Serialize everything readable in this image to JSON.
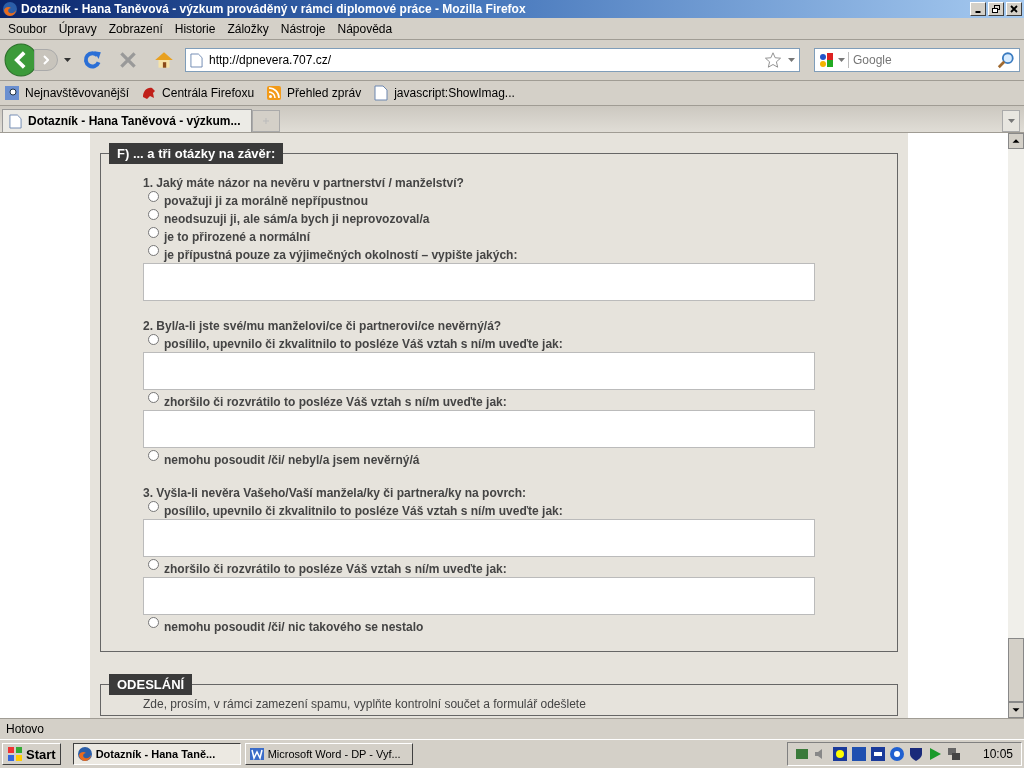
{
  "window": {
    "title": "Dotazník - Hana Taněvová - výzkum prováděný v rámci diplomové práce - Mozilla Firefox"
  },
  "menu": [
    "Soubor",
    "Úpravy",
    "Zobrazení",
    "Historie",
    "Záložky",
    "Nástroje",
    "Nápověda"
  ],
  "address_bar": {
    "value": "http://dpnevera.707.cz/"
  },
  "search": {
    "placeholder": "Google"
  },
  "bookmarks": [
    {
      "label": "Nejnavštěvovanější",
      "kind": "search"
    },
    {
      "label": "Centrála Firefoxu",
      "kind": "fox"
    },
    {
      "label": "Přehled zpráv",
      "kind": "rss"
    },
    {
      "label": "javascript:ShowImag...",
      "kind": "page"
    }
  ],
  "tabs": [
    {
      "label": "Dotazník - Hana Taněvová - výzkum...",
      "selected": true
    }
  ],
  "sections": [
    {
      "legend": "F) ... a tři otázky na závěr:",
      "questions": [
        {
          "text": "1. Jaký máte názor na nevěru v partnerství / manželství?",
          "options": [
            {
              "label": "považuji ji za morálně nepřípustnou",
              "checked": false,
              "has_field": false
            },
            {
              "label": "neodsuzuji ji, ale sám/a bych ji neprovozoval/a",
              "checked": false,
              "has_field": false
            },
            {
              "label": "je to přirozené a normální",
              "checked": false,
              "has_field": false
            },
            {
              "label": "je přípustná pouze za výjimečných okolností – vypište jakých:",
              "checked": false,
              "has_field": true
            }
          ]
        },
        {
          "text": "2. Byl/a-li jste své/mu manželovi/ce či partnerovi/ce nevěrný/á?",
          "options": [
            {
              "label": "posílilo, upevnilo či zkvalitnilo to posléze Váš vztah s ní/m uveďte jak:",
              "checked": false,
              "has_field": true
            },
            {
              "label": "zhoršilo či rozvrátilo to posléze Váš vztah s ní/m uveďte jak:",
              "checked": false,
              "has_field": true
            },
            {
              "label": "nemohu posoudit /či/ nebyl/a jsem nevěrný/á",
              "checked": false,
              "has_field": false
            }
          ]
        },
        {
          "text": "3. Vyšla-li nevěra Vašeho/Vaší manžela/ky či partnera/ky na povrch:",
          "options": [
            {
              "label": "posílilo, upevnilo či zkvalitnilo to posléze Váš vztah s ní/m uveďte jak:",
              "checked": false,
              "has_field": true
            },
            {
              "label": "zhoršilo či rozvrátilo to posléze Váš vztah s ní/m uveďte jak:",
              "checked": false,
              "has_field": true
            },
            {
              "label": "nemohu posoudit /či/ nic takového se nestalo",
              "checked": false,
              "has_field": false
            }
          ]
        }
      ]
    },
    {
      "legend": "ODESLÁNÍ",
      "intro": "Zde, prosím, v rámci zamezení spamu, vyplňte kontrolní součet a formulář odešlete"
    }
  ],
  "status_bar": "Hotovo",
  "taskbar": {
    "start": "Start",
    "tasks": [
      {
        "label": "Dotazník - Hana Taně...",
        "selected": true,
        "kind": "firefox"
      },
      {
        "label": "Microsoft Word - DP - Vyf...",
        "selected": false,
        "kind": "word"
      }
    ],
    "clock": "10:05"
  }
}
